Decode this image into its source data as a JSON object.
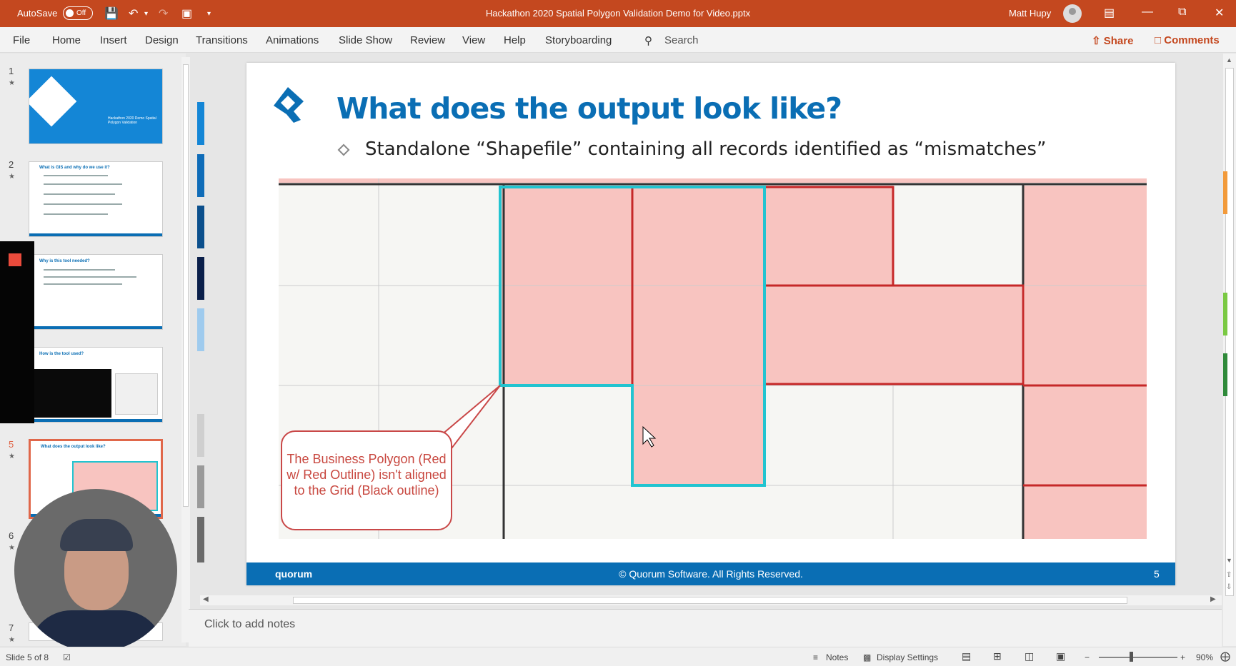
{
  "titlebar": {
    "autosave_label": "AutoSave",
    "autosave_state": "Off",
    "document_title": "Hackathon 2020 Spatial Polygon Validation Demo for Video.pptx",
    "user_name": "Matt Hupy"
  },
  "menu": {
    "tabs": [
      "File",
      "Home",
      "Insert",
      "Design",
      "Transitions",
      "Animations",
      "Slide Show",
      "Review",
      "View",
      "Help",
      "Storyboarding"
    ],
    "search_label": "Search",
    "share_label": "Share",
    "comments_label": "Comments"
  },
  "thumbnails": {
    "numbers": [
      "1",
      "2",
      "3",
      "4",
      "5",
      "6",
      "7"
    ],
    "slide1_title": "Hackathon 2020 Demo Spatial Polygon Validation",
    "slide2_title": "What is GIS and why do we use it?",
    "slide3_title": "Why is this tool needed?",
    "slide4_title": "How is the tool used?",
    "slide5_title": "What does the output look like?"
  },
  "slide": {
    "title": "What does the output look like?",
    "bullet": "Standalone “Shapefile” containing all records identified as “mismatches”",
    "callout": "The Business Polygon (Red w/ Red Outline) isn't aligned to the Grid (Black outline)",
    "footer_brand": "quorum",
    "footer_copyright": "© Quorum Software. All Rights Reserved.",
    "page_number": "5",
    "colors": {
      "title": "#0a6eb4",
      "polygon_fill": "#f8c4c0",
      "polygon_outline": "#c62828",
      "highlight_outline": "#22c4d0",
      "grid": "#333333"
    }
  },
  "notes": {
    "placeholder": "Click to add notes"
  },
  "status": {
    "slide_indicator": "Slide 5 of 8",
    "notes_label": "Notes",
    "display_settings_label": "Display Settings",
    "zoom": "90%"
  }
}
